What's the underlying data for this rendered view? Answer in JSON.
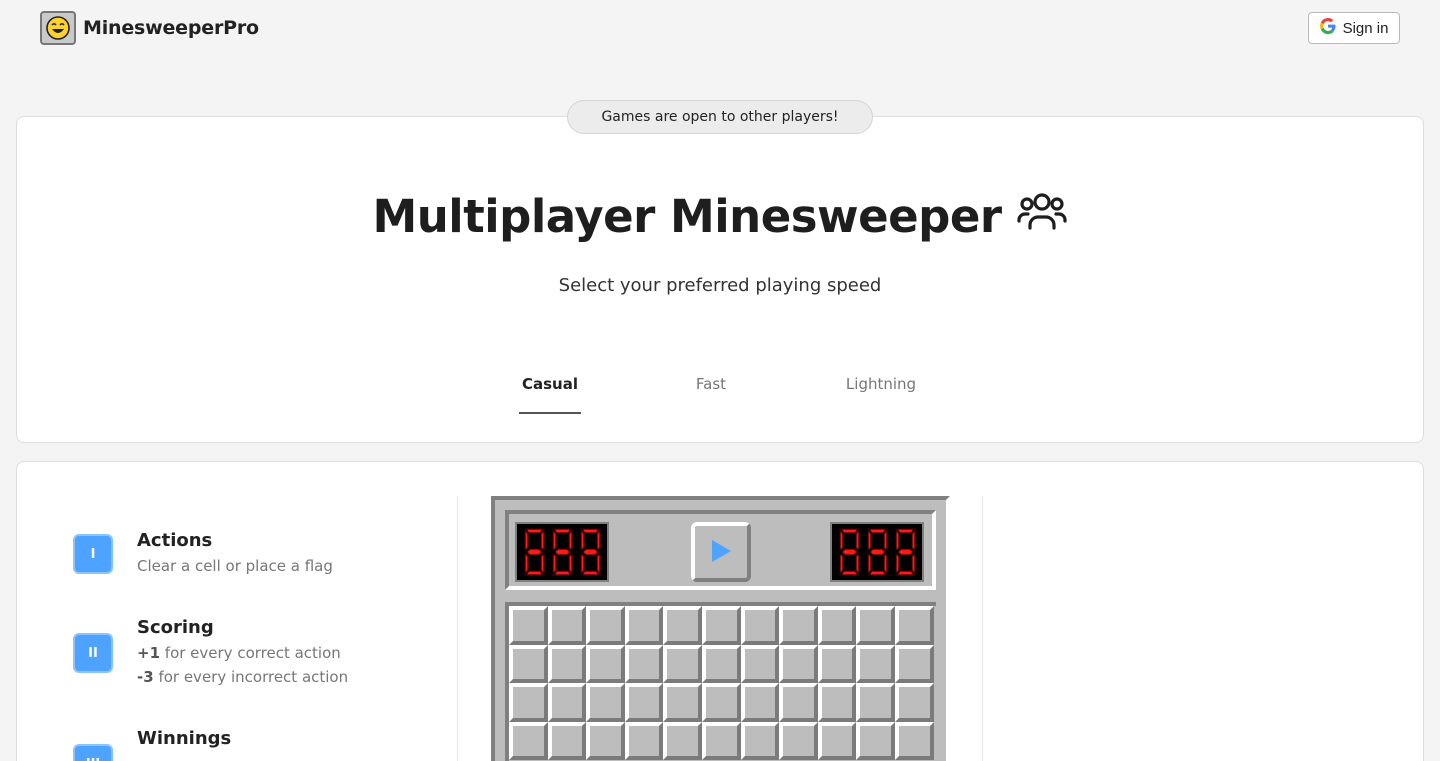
{
  "header": {
    "logo_text": "MinesweeperPro",
    "logo_icon": "smiley-face-icon",
    "signin_label": "Sign in",
    "signin_icon": "google-g-icon"
  },
  "hero": {
    "pill_text": "Games are open to other players!",
    "title": "Multiplayer Minesweeper",
    "title_icon": "users-group-icon",
    "subtitle": "Select your preferred playing speed",
    "tabs": [
      {
        "label": "Casual",
        "active": true
      },
      {
        "label": "Fast",
        "active": false
      },
      {
        "label": "Lightning",
        "active": false
      }
    ]
  },
  "rules": [
    {
      "badge": "I",
      "title": "Actions",
      "lines": [
        "Clear a cell or place a flag"
      ]
    },
    {
      "badge": "II",
      "title": "Scoring",
      "lines": [
        {
          "strong": "+1",
          "text": " for every correct action"
        },
        {
          "strong": "-3",
          "text": " for every incorrect action"
        }
      ]
    },
    {
      "badge": "III",
      "title": "Winnings",
      "lines": []
    }
  ],
  "game": {
    "left_counter": "888",
    "right_counter": "888",
    "play_icon": "play-icon",
    "grid_columns": 11,
    "grid_rows_visible": 4
  },
  "colors": {
    "accent": "#4da3ff",
    "digit_on": "#ff1a1a",
    "digit_off": "#3a0000",
    "play": "#4da3ff"
  }
}
